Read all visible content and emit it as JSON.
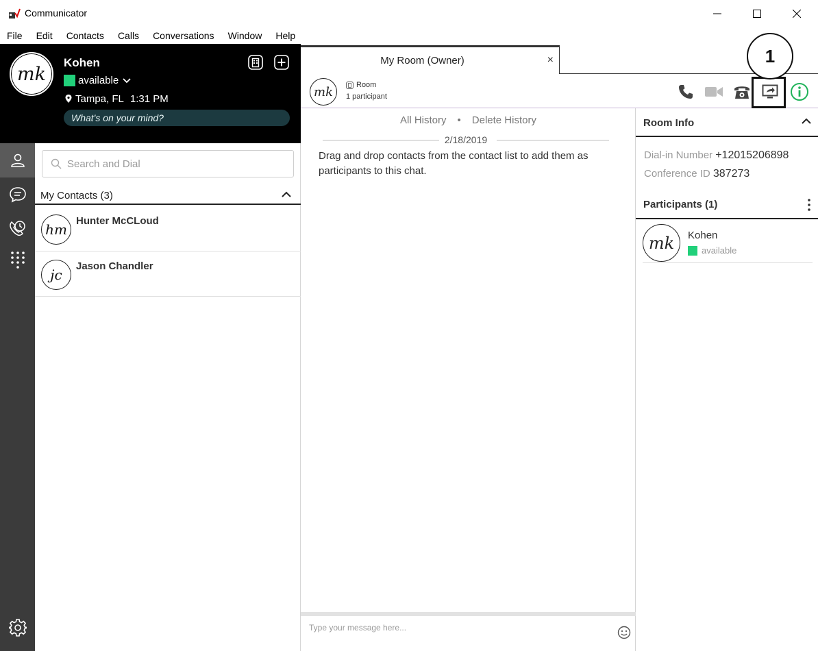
{
  "window": {
    "title": "Communicator"
  },
  "menu": [
    "File",
    "Edit",
    "Contacts",
    "Calls",
    "Conversations",
    "Window",
    "Help"
  ],
  "profile": {
    "initials": "mk",
    "name": "Kohen",
    "status": "available",
    "location": "Tampa, FL",
    "time": "1:31 PM",
    "mood_placeholder": "What's on your mind?"
  },
  "rail": {
    "items": [
      "contacts-icon",
      "chat-icon",
      "call-history-icon",
      "dialpad-icon"
    ],
    "footer": "settings-icon"
  },
  "contacts": {
    "search_placeholder": "Search and Dial",
    "group_label": "My Contacts (3)",
    "list": [
      {
        "initials": "hm",
        "name": "Hunter McCLoud"
      },
      {
        "initials": "jc",
        "name": "Jason Chandler"
      }
    ]
  },
  "tab": {
    "label": "My Room (Owner)",
    "close": "×"
  },
  "room": {
    "initials": "mk",
    "type": "Room",
    "participants": "1 participant"
  },
  "callout": {
    "number": "1"
  },
  "chat": {
    "all_history": "All History",
    "separator": "•",
    "delete_history": "Delete History",
    "date": "2/18/2019",
    "hint": "Drag and drop contacts from the contact list to add them as participants to this chat.",
    "composer_placeholder": "Type your message here..."
  },
  "info": {
    "title": "Room Info",
    "dialin_label": "Dial-in Number",
    "dialin_value": "+12015206898",
    "conf_label": "Conference ID",
    "conf_value": "387273",
    "participants_title": "Participants (1)",
    "participant": {
      "initials": "mk",
      "name": "Kohen",
      "status": "available"
    }
  },
  "colors": {
    "available": "#21d07a",
    "info_accent": "#21b35a",
    "rail_bg": "#3b3b3b",
    "profile_bg": "#000000"
  }
}
